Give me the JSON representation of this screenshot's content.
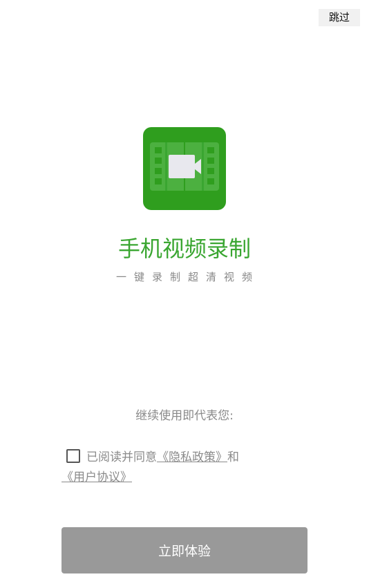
{
  "header": {
    "skip_label": "跳过"
  },
  "app": {
    "title": "手机视频录制",
    "subtitle": "一键录制超清视频",
    "icon": "video-camera-film-icon",
    "brand_color": "#2f9e1e",
    "title_color": "#3aa631"
  },
  "consent": {
    "intro": "继续使用即代表您:",
    "prefix": "已阅读并同意",
    "privacy_link": "《隐私政策》",
    "joiner": "和",
    "terms_link": "《用户协议》",
    "checked": false
  },
  "cta": {
    "label": "立即体验",
    "color": "#999999"
  }
}
